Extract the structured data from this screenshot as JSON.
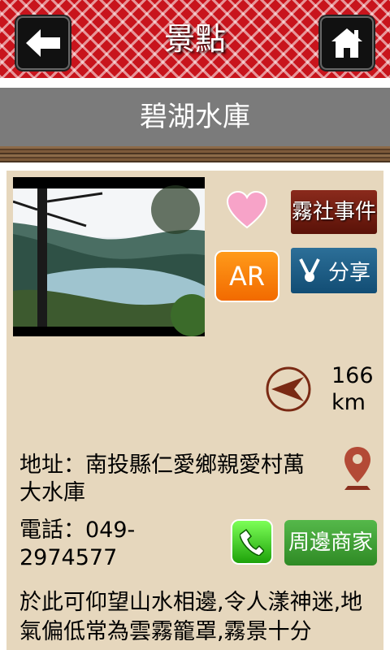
{
  "header": {
    "title": "景點",
    "back_icon": "arrow-left-icon",
    "home_icon": "home-icon"
  },
  "subtitle": "碧湖水庫",
  "actions": {
    "favorite_icon": "heart-icon",
    "wushe_label": "霧社事件",
    "ar_label": "AR",
    "share_label": "分享",
    "share_icon": "share-icon"
  },
  "distance": {
    "value": "166",
    "unit": "km",
    "icon": "direction-arrow-icon"
  },
  "address": {
    "label": "地址：",
    "text": "南投縣仁愛鄉親愛村萬大水庫",
    "icon": "map-pin-icon"
  },
  "phone": {
    "label": "電話：",
    "number": "049-2974577",
    "icon": "phone-icon"
  },
  "nearby_label": "周邊商家",
  "description": "於此可仰望山水相邊,令人漾神迷,地氣偏低常為雲霧籠罩,霧景十分",
  "colors": {
    "header_red": "#c8141c",
    "content_bg": "#e6d7bd",
    "wushe_btn": "#6e1e12",
    "ar_btn": "#f2780a",
    "share_btn": "#1c5a84",
    "nearby_btn": "#3f9e33",
    "heart": "#f7a3c8"
  }
}
